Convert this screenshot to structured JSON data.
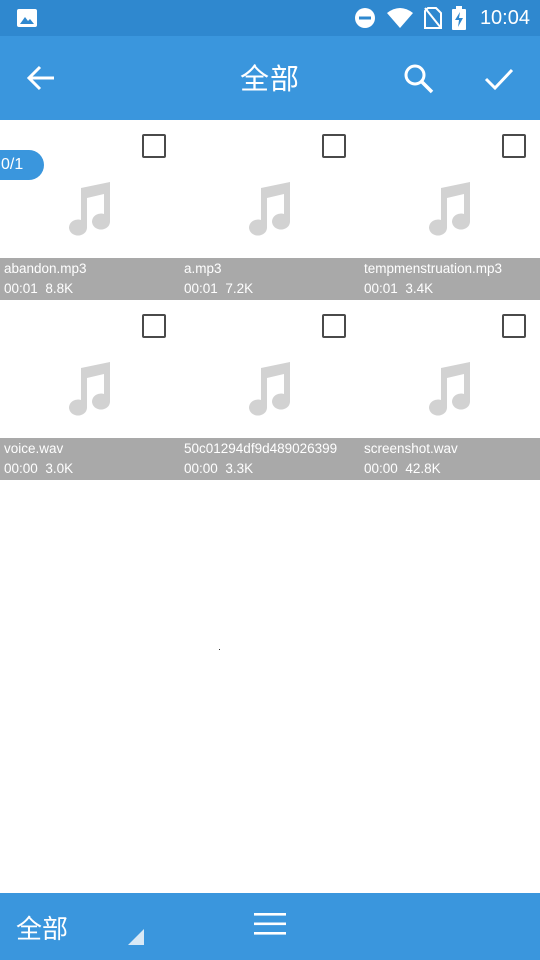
{
  "status_bar": {
    "time": "10:04",
    "icons": [
      "gallery-icon",
      "do-not-disturb-icon",
      "wifi-icon",
      "no-sim-icon",
      "battery-charging-icon"
    ]
  },
  "app_bar": {
    "title": "全部",
    "icons": [
      "back-arrow-icon",
      "search-icon",
      "check-icon"
    ]
  },
  "selection_counter": "0/1",
  "files": [
    {
      "name": "abandon.mp3",
      "duration": "00:01",
      "size": "8.8K"
    },
    {
      "name": "a.mp3",
      "duration": "00:01",
      "size": "7.2K"
    },
    {
      "name": "tempmenstruation.mp3",
      "duration": "00:01",
      "size": "3.4K"
    },
    {
      "name": "voice.wav",
      "duration": "00:00",
      "size": "3.0K"
    },
    {
      "name": "50c01294df9d489026399",
      "duration": "00:00",
      "size": "3.3K"
    },
    {
      "name": "screenshot.wav",
      "duration": "00:00",
      "size": "42.8K"
    }
  ],
  "bottom_bar": {
    "category": "全部",
    "icons": [
      "dropdown-corner-icon",
      "menu-icon"
    ]
  },
  "colors": {
    "status_bar": "#2f88cf",
    "primary": "#3a96dd",
    "info_strip": "#a9a9a9",
    "music_icon": "#d2d2d2"
  }
}
